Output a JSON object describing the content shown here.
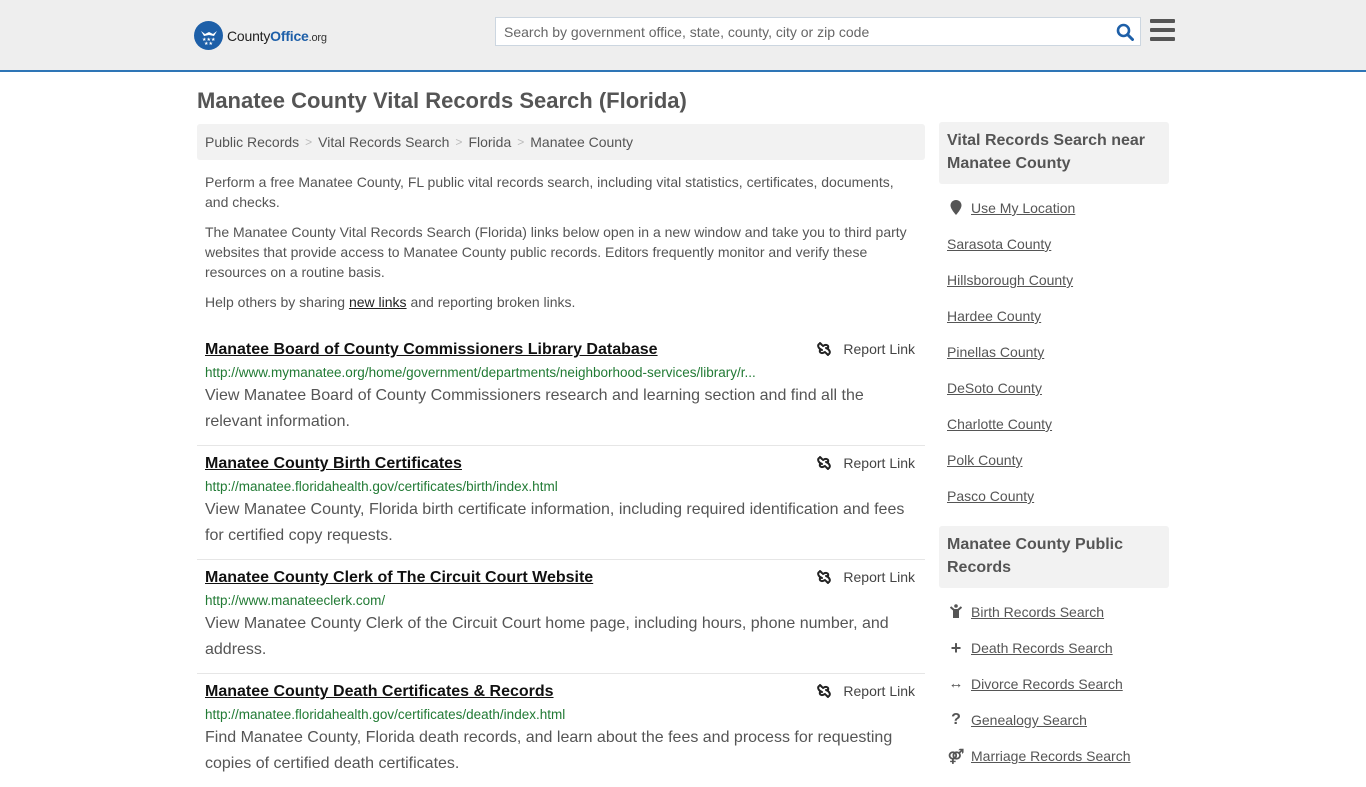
{
  "header": {
    "logo": {
      "brand_county": "County",
      "brand_office": "Office",
      "brand_tld": ".org"
    },
    "search": {
      "placeholder": "Search by government office, state, county, city or zip code",
      "value": ""
    },
    "icons": {
      "search": "search-icon",
      "menu": "hamburger-menu-icon"
    }
  },
  "page": {
    "title": "Manatee County Vital Records Search (Florida)"
  },
  "breadcrumb": [
    {
      "label": "Public Records"
    },
    {
      "label": "Vital Records Search"
    },
    {
      "label": "Florida"
    },
    {
      "label": "Manatee County"
    }
  ],
  "intro": {
    "p1": "Perform a free Manatee County, FL public vital records search, including vital statistics, certificates, documents, and checks.",
    "p2": "The Manatee County Vital Records Search (Florida) links below open in a new window and take you to third party websites that provide access to Manatee County public records. Editors frequently monitor and verify these resources on a routine basis.",
    "p3_before": "Help others by sharing ",
    "p3_link": "new links",
    "p3_after": " and reporting broken links."
  },
  "results": [
    {
      "title": "Manatee Board of County Commissioners Library Database",
      "url": "http://www.mymanatee.org/home/government/departments/neighborhood-services/library/r...",
      "description": "View Manatee Board of County Commissioners research and learning section and find all the relevant information.",
      "report_label": "Report Link"
    },
    {
      "title": "Manatee County Birth Certificates",
      "url": "http://manatee.floridahealth.gov/certificates/birth/index.html",
      "description": "View Manatee County, Florida birth certificate information, including required identification and fees for certified copy requests.",
      "report_label": "Report Link"
    },
    {
      "title": "Manatee County Clerk of The Circuit Court Website",
      "url": "http://www.manateeclerk.com/",
      "description": "View Manatee County Clerk of the Circuit Court home page, including hours, phone number, and address.",
      "report_label": "Report Link"
    },
    {
      "title": "Manatee County Death Certificates & Records",
      "url": "http://manatee.floridahealth.gov/certificates/death/index.html",
      "description": "Find Manatee County, Florida death records, and learn about the fees and process for requesting copies of certified death certificates.",
      "report_label": "Report Link"
    }
  ],
  "sidebar": {
    "nearby": {
      "heading": "Vital Records Search near Manatee County",
      "use_location": "Use My Location",
      "counties": [
        "Sarasota County",
        "Hillsborough County",
        "Hardee County",
        "Pinellas County",
        "DeSoto County",
        "Charlotte County",
        "Polk County",
        "Pasco County"
      ]
    },
    "public_records": {
      "heading": "Manatee County Public Records",
      "items": [
        {
          "label": "Birth Records Search",
          "icon": "child-icon"
        },
        {
          "label": "Death Records Search",
          "icon": "plus-icon"
        },
        {
          "label": "Divorce Records Search",
          "icon": "double-arrow-icon"
        },
        {
          "label": "Genealogy Search",
          "icon": "question-icon"
        },
        {
          "label": "Marriage Records Search",
          "icon": "marriage-icon"
        }
      ]
    }
  }
}
